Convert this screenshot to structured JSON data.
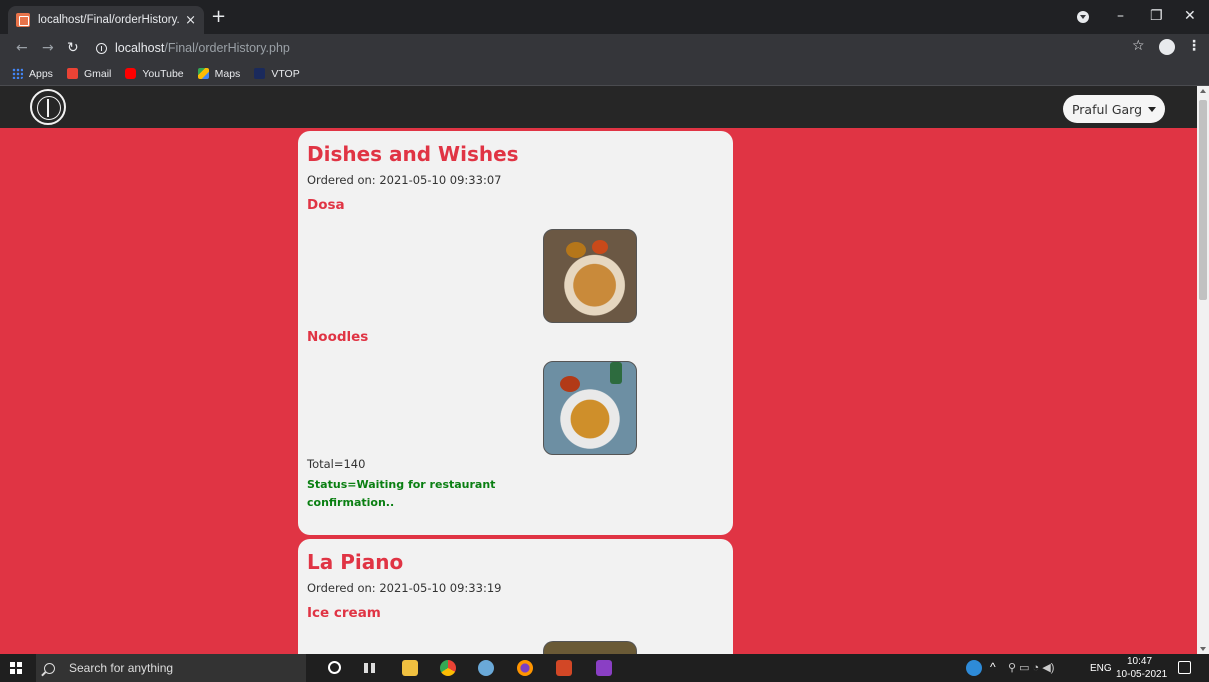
{
  "browser": {
    "tab_title": "localhost/Final/orderHistory.php",
    "tab_close": "×",
    "new_tab": "+",
    "url_host": "localhost",
    "url_path": "/Final/orderHistory.php",
    "bookmarks": [
      "Apps",
      "Gmail",
      "YouTube",
      "Maps",
      "VTOP"
    ]
  },
  "navbar": {
    "user_name": "Praful Garg"
  },
  "orders": [
    {
      "restaurant": "Dishes and Wishes",
      "ordered_on": "Ordered on: 2021-05-10 09:33:07",
      "items": [
        "Dosa",
        "Noodles"
      ],
      "total": "Total=140",
      "status": "Status=Waiting for restaurant confirmation.."
    },
    {
      "restaurant": "La Piano",
      "ordered_on": "Ordered on: 2021-05-10 09:33:19",
      "items": [
        "Ice cream"
      ]
    }
  ],
  "taskbar": {
    "search_placeholder": "Search for anything",
    "language": "ENG",
    "time": "10:47",
    "date": "10-05-2021"
  }
}
